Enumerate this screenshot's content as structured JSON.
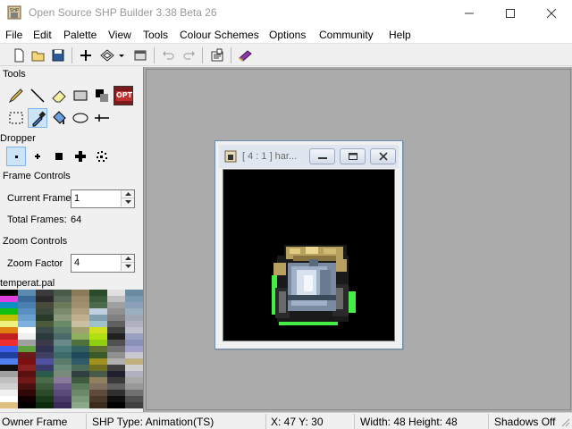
{
  "window": {
    "title": "Open Source SHP Builder 3.38 Beta 26",
    "app_icon": "shp-app-icon",
    "controls": [
      "minimize-icon",
      "maximize-icon",
      "close-icon"
    ]
  },
  "menu": [
    "File",
    "Edit",
    "Palette",
    "View",
    "Tools",
    "Colour Schemes",
    "Options",
    "Community",
    "Help"
  ],
  "toolbar": {
    "buttons": [
      "new-file-icon",
      "open-folder-icon",
      "save-disk-icon",
      "add-frame-icon",
      "grid-pattern-icon",
      "dropdown-arrow-icon",
      "preview-window-icon",
      "undo-icon",
      "redo-icon",
      "properties-icon",
      "palette-book-icon"
    ]
  },
  "left_panel": {
    "tools_label": "Tools",
    "tools": [
      "pencil-icon",
      "line-icon",
      "eraser-icon",
      "rectangle-icon",
      "flood-fill-icon",
      "opt-icon",
      "select-rect-icon",
      "dropper-icon",
      "fill-bucket-icon",
      "ellipse-icon",
      "crosshair-icon"
    ],
    "opt_text": "OPT",
    "dropper_label": "Dropper",
    "dropper_sizes": [
      "dot-small-icon",
      "dot-plus-icon",
      "dot-square-icon",
      "dot-large-icon",
      "dot-spray-icon"
    ],
    "frame_controls_label": "Frame Controls",
    "current_frame_label": "Current Frame",
    "current_frame_value": "1",
    "total_frames_label": "Total Frames:",
    "total_frames_value": "64",
    "zoom_controls_label": "Zoom Controls",
    "zoom_factor_label": "Zoom Factor",
    "zoom_factor_value": "4",
    "palette_name": "temperat.pal"
  },
  "child_window": {
    "title": "[ 4 : 1 ] har...",
    "icon": "shp-doc-icon",
    "controls": [
      "child-minimize-icon",
      "child-restore-icon",
      "child-close-icon"
    ]
  },
  "status": {
    "owner": "Owner Frame",
    "type": "SHP Type: Animation(TS)",
    "coords": "X: 47 Y: 30",
    "size": "Width: 48 Height: 48",
    "shadows": "Shadows Off"
  },
  "colors": {
    "workspace_bg": "#ababab",
    "selection": "#cce4f7",
    "sprite_green": "#44ee44"
  },
  "palette_colors": [
    "#000000",
    "#5a8ab0",
    "#3a3a3a",
    "#4a5a4a",
    "#8a7a5a",
    "#2a4a2a",
    "#e0e0e0",
    "#6a8aa0",
    "#e040e0",
    "#3a6a9a",
    "#2a2a2a",
    "#5a6a5a",
    "#9a8a6a",
    "#3a5a3a",
    "#c0c0c0",
    "#7a9ab0",
    "#1090c0",
    "#4a80b0",
    "#4a4a3a",
    "#6a7a5a",
    "#a09070",
    "#4a6a4a",
    "#a0a0a0",
    "#8aa0b8",
    "#10c010",
    "#5a90c0",
    "#3a4a3a",
    "#7a8a6a",
    "#b0a080",
    "#c0d0e0",
    "#909090",
    "#9ab0c0",
    "#c0c000",
    "#6aa0d0",
    "#2a3a2a",
    "#8a9a7a",
    "#c0b090",
    "#80a0b0",
    "#808080",
    "#a0a8b8",
    "#f0f080",
    "#80b0e0",
    "#4a5a3a",
    "#6a8a6a",
    "#c8c0a0",
    "#a0c0c8",
    "#606060",
    "#b0b0c0",
    "#e08010",
    "#ffffff",
    "#3a4a4a",
    "#5a7a6a",
    "#a0a070",
    "#d0e020",
    "#404040",
    "#c0c0d0",
    "#c02020",
    "#f0f0f0",
    "#2a3a3a",
    "#4a6a6a",
    "#90b060",
    "#b0e010",
    "#202020",
    "#9aa0c0",
    "#f03030",
    "#a0a0a0",
    "#3a3a4a",
    "#6a8a8a",
    "#507040",
    "#90d010",
    "#505050",
    "#8890b8",
    "#4060f0",
    "#60a040",
    "#303050",
    "#4a7a7a",
    "#306060",
    "#607030",
    "#707070",
    "#a0a0c8",
    "#2040a0",
    "#6a1a1a",
    "#404060",
    "#3a6a6a",
    "#204a5a",
    "#3a5a2a",
    "#909090",
    "#c8c8d0",
    "#5080f0",
    "#7a1010",
    "#5050a0",
    "#5a7a6a",
    "#305a6a",
    "#a09020",
    "#b0b0b0",
    "#c0b080",
    "#101010",
    "#8a2020",
    "#3a3a6a",
    "#6a8a7a",
    "#4a6a5a",
    "#707020",
    "#404040",
    "#d0d0d0",
    "#a0a0a0",
    "#5a1010",
    "#2a5a4a",
    "#7a8a7a",
    "#304040",
    "#4a5a4a",
    "#202030",
    "#b0b0c0",
    "#c0c0c0",
    "#701818",
    "#4a6a4a",
    "#8a7a9a",
    "#405a40",
    "#908060",
    "#3a3a3a",
    "#a8a8a8",
    "#d0d0d0",
    "#4a1010",
    "#3a5a3a",
    "#6a5a8a",
    "#5a7a5a",
    "#807060",
    "#606060",
    "#989898",
    "#f0f0f0",
    "#300808",
    "#2a4a2a",
    "#5a4a7a",
    "#6a8a6a",
    "#604a3a",
    "#303030",
    "#707070",
    "#ffffff",
    "#100000",
    "#1a3a1a",
    "#4a3a6a",
    "#7a9a7a",
    "#4a3a2a",
    "#101010",
    "#505050",
    "#e0c080",
    "#000000",
    "#0a2a0a",
    "#3a2a5a",
    "#8aaa8a",
    "#3a2a1a",
    "#000000",
    "#404040"
  ]
}
